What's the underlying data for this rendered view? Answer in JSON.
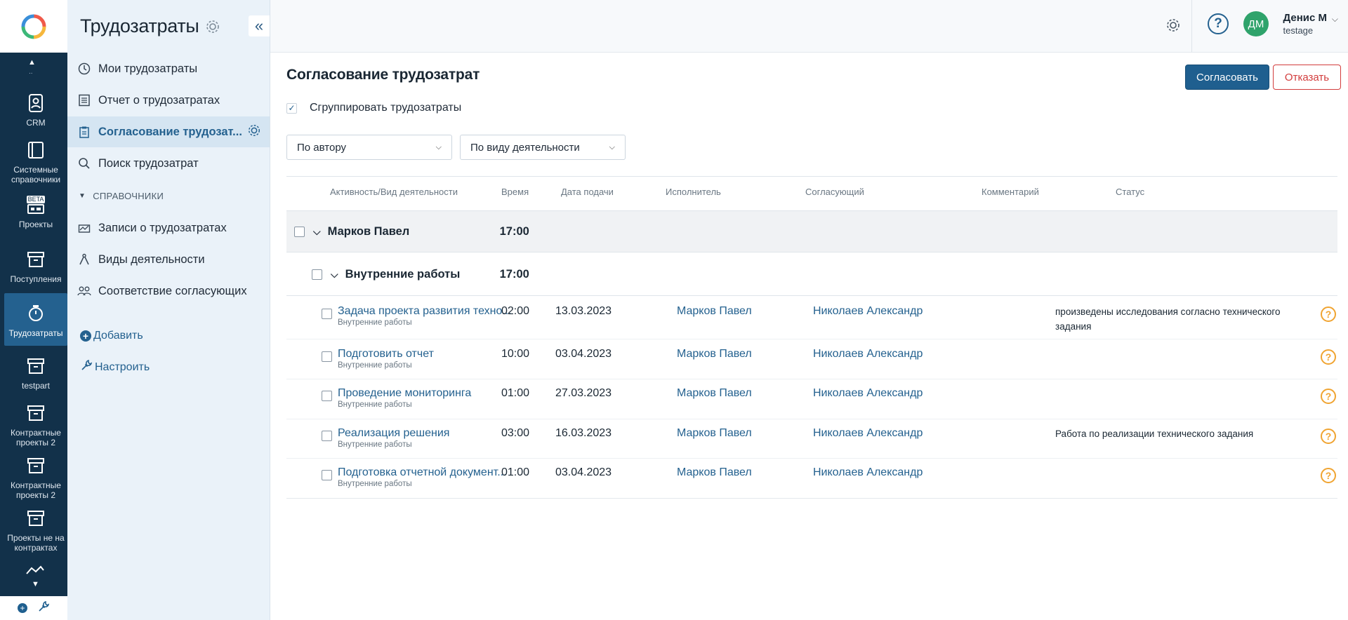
{
  "rail": {
    "items": [
      {
        "label": "CRM",
        "icon": "contact-book-icon"
      },
      {
        "label": "Системные справочники",
        "icon": "book-icon"
      },
      {
        "label": "Проекты",
        "icon": "beta-projects-icon",
        "badge": "BETA"
      },
      {
        "label": "Поступления",
        "icon": "archive-box-icon"
      },
      {
        "label": "Трудозатраты",
        "icon": "stopwatch-icon"
      },
      {
        "label": "testpart",
        "icon": "archive-box-icon"
      },
      {
        "label": "Контрактные проекты 2",
        "icon": "archive-box-icon"
      },
      {
        "label": "Контрактные проекты 2",
        "icon": "archive-box-icon"
      },
      {
        "label": "Проекты не на контрактах",
        "icon": "archive-box-icon"
      }
    ]
  },
  "sidebar": {
    "title": "Трудозатраты",
    "items": [
      {
        "label": "Мои трудозатраты",
        "icon": "clock-icon"
      },
      {
        "label": "Отчет о трудозатратах",
        "icon": "report-list-icon"
      },
      {
        "label": "Согласование трудозат...",
        "icon": "clipboard-icon"
      },
      {
        "label": "Поиск трудозатрат",
        "icon": "search-icon"
      }
    ],
    "section_label": "СПРАВОЧНИКИ",
    "ref_items": [
      {
        "label": "Записи о трудозатратах",
        "icon": "records-icon"
      },
      {
        "label": "Виды деятельности",
        "icon": "compass-icon"
      },
      {
        "label": "Соответствие согласующих",
        "icon": "users-icon"
      }
    ],
    "add_label": "Добавить",
    "configure_label": "Настроить"
  },
  "header": {
    "help": "?",
    "avatar_initials": "ДМ",
    "user_name": "Денис М",
    "user_login": "testage"
  },
  "main": {
    "title": "Согласование трудозатрат",
    "approve_label": "Согласовать",
    "reject_label": "Отказать",
    "group_label": "Сгруппировать трудозатраты",
    "group_checked": "✓",
    "filter_author": "По автору",
    "filter_activity": "По виду деятельности"
  },
  "table": {
    "headers": {
      "activity": "Активность/Вид деятельности",
      "time": "Время",
      "date": "Дата подачи",
      "executor": "Исполнитель",
      "approver": "Согласующий",
      "comment": "Комментарий",
      "status": "Статус"
    },
    "group1": {
      "name": "Марков Павел",
      "time": "17:00"
    },
    "group2": {
      "name": "Внутренние работы",
      "time": "17:00"
    },
    "rows": [
      {
        "task": "Задача проекта развития техно...",
        "sub": "Внутренние работы",
        "time": "02:00",
        "date": "13.03.2023",
        "executor": "Марков Павел",
        "approver": "Николаев Александр",
        "comment": "произведены исследования согласно технического задания",
        "status": "?"
      },
      {
        "task": "Подготовить отчет",
        "sub": "Внутренние работы",
        "time": "10:00",
        "date": "03.04.2023",
        "executor": "Марков Павел",
        "approver": "Николаев Александр",
        "comment": "",
        "status": "?"
      },
      {
        "task": "Проведение мониторинга",
        "sub": "Внутренние работы",
        "time": "01:00",
        "date": "27.03.2023",
        "executor": "Марков Павел",
        "approver": "Николаев Александр",
        "comment": "",
        "status": "?"
      },
      {
        "task": "Реализация решения",
        "sub": "Внутренние работы",
        "time": "03:00",
        "date": "16.03.2023",
        "executor": "Марков Павел",
        "approver": "Николаев Александр",
        "comment": "Работа по реализации технического задания",
        "status": "?"
      },
      {
        "task": "Подготовка отчетной документ...",
        "sub": "Внутренние работы",
        "time": "01:00",
        "date": "03.04.2023",
        "executor": "Марков Павел",
        "approver": "Николаев Александр",
        "comment": "",
        "status": "?"
      }
    ]
  },
  "colors": {
    "rail_bg": "#12314a",
    "rail_active": "#24618f",
    "accent": "#24618f",
    "approve_btn": "#1f5f8f",
    "reject": "#d23c3c",
    "status_pending": "#f0a431",
    "avatar": "#2fa36b"
  }
}
